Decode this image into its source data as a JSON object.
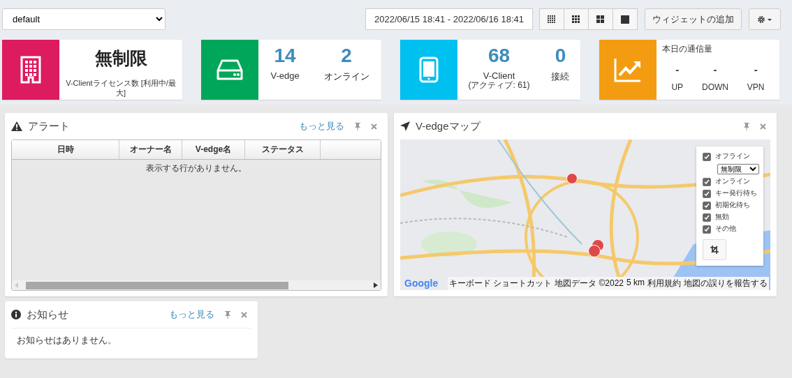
{
  "toolbar": {
    "profile_select": "default",
    "date_range": "2022/06/15 18:41 - 2022/06/16 18:41",
    "layout_buttons": [
      {
        "kind": "grid4"
      },
      {
        "kind": "grid3"
      },
      {
        "kind": "grid2"
      },
      {
        "kind": "grid1"
      }
    ],
    "add_widget_button": "ウィジェットの追加"
  },
  "stat_cards": [
    {
      "kind": "license",
      "color": "#dd1b5f",
      "value": "無制限",
      "label": "V-Clientライセンス数 [利用中/最大]"
    },
    {
      "kind": "vedge",
      "color": "#00a65a",
      "metrics": [
        {
          "value": "14",
          "label": "V-edge"
        },
        {
          "value": "2",
          "label": "オンライン"
        }
      ]
    },
    {
      "kind": "vclient",
      "color": "#00c0ef",
      "metrics": [
        {
          "value": "68",
          "label": "V-Client",
          "note": "(アクティブ: 61)"
        },
        {
          "value": "0",
          "label": "接続"
        }
      ]
    },
    {
      "kind": "traffic",
      "color": "#f39c12",
      "title": "本日の通信量",
      "metrics": [
        {
          "value": "-",
          "label": "UP"
        },
        {
          "value": "-",
          "label": "DOWN"
        },
        {
          "value": "-",
          "label": "VPN"
        }
      ]
    }
  ],
  "alert_widget": {
    "title": "アラート",
    "more_link": "もっと見る",
    "columns": [
      "日時",
      "オーナー名",
      "V-edge名",
      "ステータス"
    ],
    "empty_message": "表示する行がありません。"
  },
  "map_widget": {
    "title": "V-edgeマップ",
    "legend": [
      {
        "label": "オフライン",
        "checked": true,
        "select": "無制限"
      },
      {
        "label": "オンライン",
        "checked": true
      },
      {
        "label": "キー発行待ち",
        "checked": true
      },
      {
        "label": "初期化待ち",
        "checked": true
      },
      {
        "label": "無効",
        "checked": true
      },
      {
        "label": "その他",
        "checked": true
      }
    ],
    "logo": "Google",
    "attribution": [
      "キーボード ショートカット",
      "地図データ ©2022",
      "5 km",
      "利用規約",
      "地図の誤りを報告する"
    ]
  },
  "notice_widget": {
    "title": "お知らせ",
    "more_link": "もっと見る",
    "empty_message": "お知らせはありません。"
  }
}
